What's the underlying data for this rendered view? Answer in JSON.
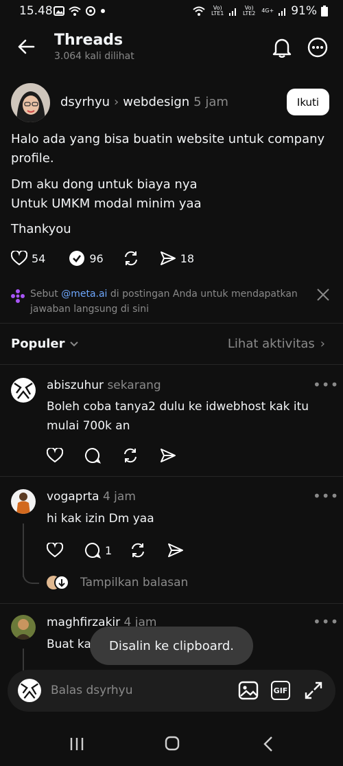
{
  "status_bar": {
    "time": "15.48",
    "battery": "91%",
    "sim1": "Vo) LTE1",
    "sim2": "Vo) LTE2",
    "net2": "4G+"
  },
  "header": {
    "title": "Threads",
    "views": "3.064 kali dilihat"
  },
  "post": {
    "author": "dsyrhyu",
    "topic": "webdesign",
    "time": "5 jam",
    "follow_label": "Ikuti",
    "paragraphs": [
      "Halo ada yang bisa buatin website untuk company profile.",
      "Dm aku dong untuk biaya nya\nUntuk UMKM modal minim yaa",
      "Thankyou"
    ],
    "likes": "54",
    "replies": "96",
    "shares": "18"
  },
  "meta_ai_note": {
    "prefix": "Sebut ",
    "mention": "@meta.ai",
    "suffix": " di postingan Anda untuk mendapatkan jawaban langsung di sini"
  },
  "sort": {
    "label": "Populer",
    "activity_link": "Lihat aktivitas"
  },
  "replies": [
    {
      "user": "abiszuhur",
      "time": "sekarang",
      "text": "Boleh coba tanya2 dulu ke idwebhost kak itu mulai 700k an",
      "reply_count": ""
    },
    {
      "user": "vogaprta",
      "time": "4 jam",
      "text": "hi kak izin Dm yaa",
      "reply_count": "1",
      "show_replies": "Tampilkan balasan"
    },
    {
      "user": "maghfirzakir",
      "time": "4 jam",
      "text": "Buat ka",
      "reply_count": ""
    }
  ],
  "toast": "Disalin ke clipboard.",
  "composer": {
    "placeholder": "Balas dsyrhyu",
    "gif_label": "GIF"
  }
}
